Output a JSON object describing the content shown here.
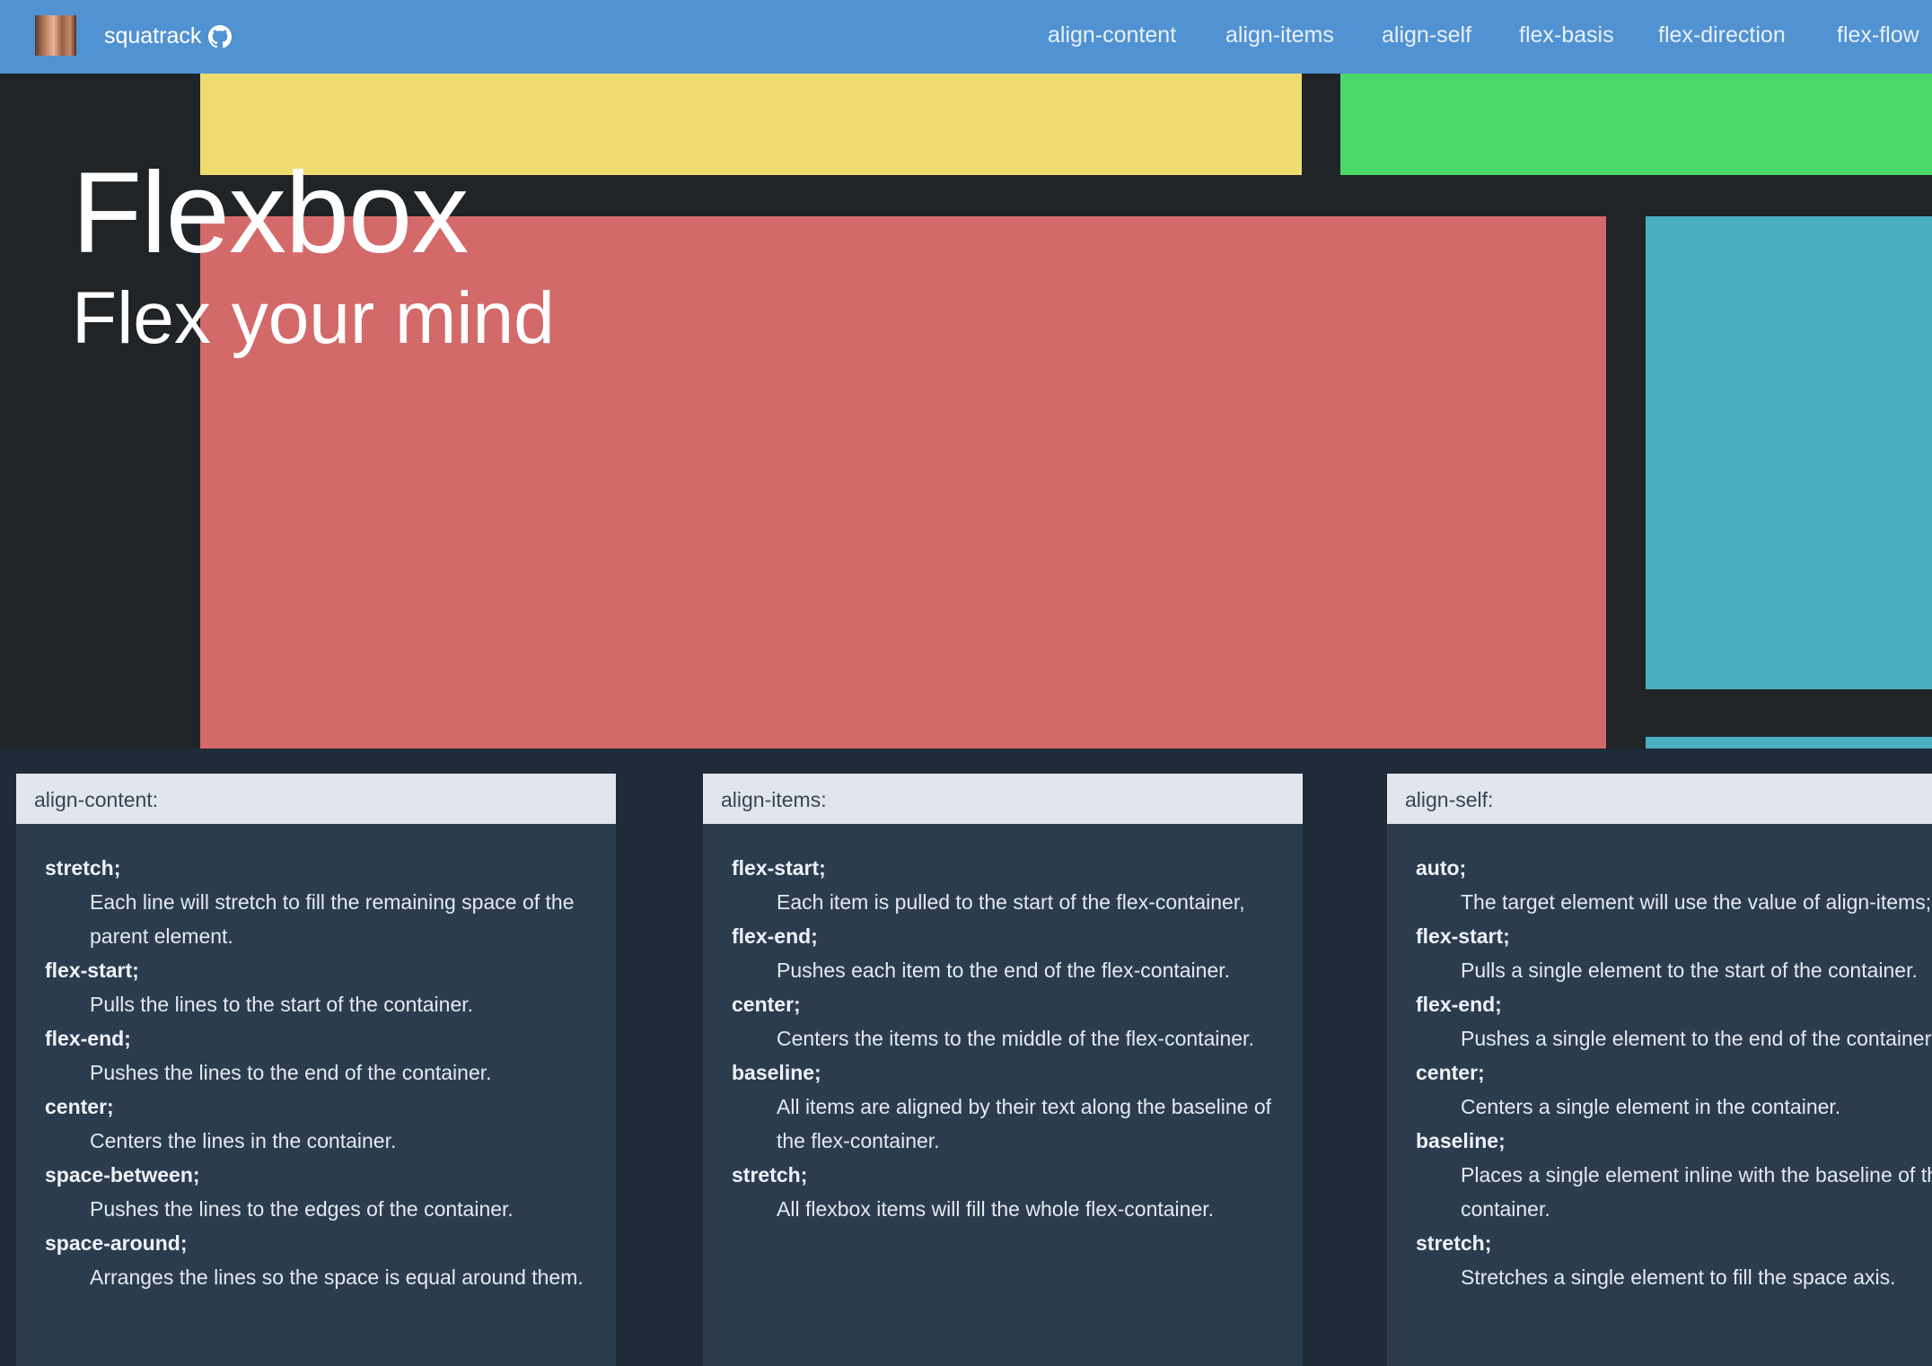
{
  "header": {
    "brand": "squatrack",
    "nav": [
      "align-content",
      "align-items",
      "align-self",
      "flex-basis",
      "flex-direction",
      "flex-flow"
    ]
  },
  "hero": {
    "title": "Flexbox",
    "subtitle": "Flex your mind"
  },
  "colors": {
    "topbar": "#5192d2",
    "hero_bg": "#212427",
    "yellow": "#eedc70",
    "green": "#4ad869",
    "red": "#d4696a",
    "cyan": "#4aaec2",
    "card_bg": "#2b3c4f",
    "card_head": "#e1e6ee"
  },
  "cards": [
    {
      "title": "align-content:",
      "items": [
        {
          "term": "stretch;",
          "desc": "Each line will stretch to fill the remaining space of the parent element."
        },
        {
          "term": "flex-start;",
          "desc": "Pulls the lines to the start of the container."
        },
        {
          "term": "flex-end;",
          "desc": "Pushes the lines to the end of the container."
        },
        {
          "term": "center;",
          "desc": "Centers the lines in the container."
        },
        {
          "term": "space-between;",
          "desc": "Pushes the lines to the edges of the container."
        },
        {
          "term": "space-around;",
          "desc": "Arranges the lines so the space is equal around them."
        }
      ]
    },
    {
      "title": "align-items:",
      "items": [
        {
          "term": "flex-start;",
          "desc": "Each item is pulled to the start of the flex-container,"
        },
        {
          "term": "flex-end;",
          "desc": "Pushes each item to the end of the flex-container."
        },
        {
          "term": "center;",
          "desc": "Centers the items to the middle of the flex-container."
        },
        {
          "term": "baseline;",
          "desc": "All items are aligned by their text along the baseline of the flex-container."
        },
        {
          "term": "stretch;",
          "desc": "All flexbox items will fill the whole flex-container."
        }
      ]
    },
    {
      "title": "align-self:",
      "items": [
        {
          "term": "auto;",
          "desc": "The target element will use the value of align-items;"
        },
        {
          "term": "flex-start;",
          "desc": "Pulls a single element to the start of the container."
        },
        {
          "term": "flex-end;",
          "desc": "Pushes a single element to the end of the container."
        },
        {
          "term": "center;",
          "desc": "Centers a single element in the container."
        },
        {
          "term": "baseline;",
          "desc": "Places a single element inline with the baseline of the container."
        },
        {
          "term": "stretch;",
          "desc": "Stretches a single element to fill the space axis."
        }
      ]
    }
  ]
}
